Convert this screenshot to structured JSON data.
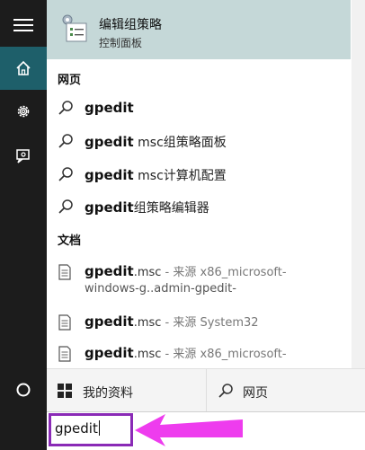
{
  "rail": {
    "items": [
      {
        "icon": "hamburger-menu-icon"
      },
      {
        "icon": "home-icon",
        "active": true
      },
      {
        "icon": "gear-icon"
      },
      {
        "icon": "feedback-icon"
      },
      {
        "icon": "cortana-circle-icon"
      }
    ]
  },
  "best_match": {
    "title": "编辑组策略",
    "subtitle": "控制面板",
    "icon": "group-policy-icon"
  },
  "web_section": {
    "heading": "网页",
    "items": [
      {
        "bold": "gpedit",
        "rest": ""
      },
      {
        "bold": "gpedit",
        "rest": " msc组策略面板"
      },
      {
        "bold": "gpedit",
        "rest": " msc计算机配置"
      },
      {
        "bold": "gpedit",
        "rest": "组策略编辑器"
      }
    ]
  },
  "doc_section": {
    "heading": "文档",
    "items": [
      {
        "bold": "gpedit",
        "ext": ".msc",
        "rest": " - 来源 x86_microsoft-",
        "line2": "windows-g..admin-gpedit-"
      },
      {
        "bold": "gpedit",
        "ext": ".msc",
        "rest": " - 来源 System32",
        "line2": ""
      },
      {
        "bold": "gpedit",
        "ext": ".msc",
        "rest": " - 来源 x86_microsoft-",
        "line2": ""
      }
    ]
  },
  "bottom": {
    "my_stuff_label": "我的资料",
    "web_label": "网页"
  },
  "search": {
    "query": "gpedit"
  },
  "colors": {
    "rail_bg": "#1c1c1c",
    "rail_active": "#1e5f6a",
    "best_match_bg": "#c5d8d8",
    "highlight_frame": "#8a2ab6",
    "annotation_arrow": "#ee3cee"
  }
}
